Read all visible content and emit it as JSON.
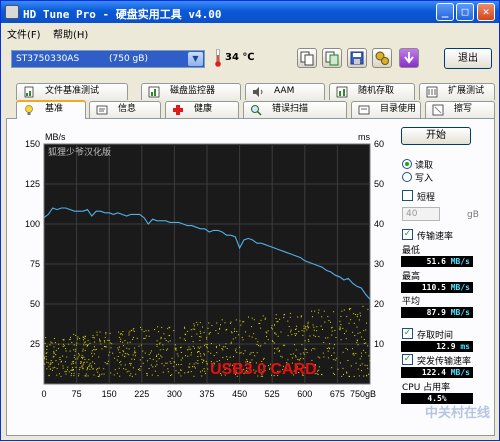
{
  "window": {
    "title": "HD Tune Pro - 硬盘实用工具 v4.00",
    "minimize_glyph": "_",
    "maximize_glyph": "□",
    "close_glyph": "✕"
  },
  "menu": {
    "file": "文件(F)",
    "help": "帮助(H)"
  },
  "toolbar": {
    "drive": "ST3750330AS",
    "drive_size": "(750 gB)",
    "temperature": "34 ℃",
    "exit_label": "退出",
    "icons": [
      "copy-text-icon",
      "copy-screenshot-icon",
      "save-icon",
      "settings-icon",
      "download-icon"
    ]
  },
  "tabs_top": [
    {
      "label": "文件基准测试",
      "icon": "file-benchmark-icon"
    },
    {
      "label": "磁盘监控器",
      "icon": "disk-monitor-icon"
    },
    {
      "label": "AAM",
      "icon": "speaker-icon"
    },
    {
      "label": "随机存取",
      "icon": "random-access-icon"
    },
    {
      "label": "扩展测试",
      "icon": "extra-tests-icon"
    }
  ],
  "tabs_bottom": [
    {
      "label": "基准",
      "icon": "lightbulb-icon"
    },
    {
      "label": "信息",
      "icon": "info-icon"
    },
    {
      "label": "健康",
      "icon": "health-cross-icon"
    },
    {
      "label": "错误扫描",
      "icon": "magnifier-icon"
    },
    {
      "label": "目录使用",
      "icon": "folder-icon"
    },
    {
      "label": "擦写",
      "icon": "erase-icon"
    }
  ],
  "side": {
    "start_label": "开始",
    "read_label": "读取",
    "write_label": "写入",
    "short_label": "短程",
    "short_value": "40",
    "short_unit": "gB",
    "transfer_rate_label": "传输速率",
    "min_label": "最低",
    "min_value": "51.6",
    "max_label": "最高",
    "max_value": "110.5",
    "avg_label": "平均",
    "avg_value": "87.9",
    "rate_unit": "MB/s",
    "access_time_label": "存取时间",
    "access_time_value": "12.9",
    "access_time_unit": "ms",
    "burst_label": "突发传输速率",
    "burst_value": "122.4",
    "cpu_label": "CPU 占用率",
    "cpu_value": "4.5%"
  },
  "watermark": "中关村在线",
  "chart_data": {
    "type": "line",
    "left_axis_label": "MB/s",
    "right_axis_label": "ms",
    "left_ticks": [
      150,
      125,
      100,
      75,
      50,
      25
    ],
    "right_ticks": [
      60,
      50,
      40,
      30,
      20,
      10
    ],
    "x_ticks": [
      "0",
      "75",
      "150",
      "225",
      "300",
      "375",
      "450",
      "525",
      "600",
      "675",
      "750gB"
    ],
    "ylim": [
      0,
      150
    ],
    "y2lim": [
      0,
      60
    ],
    "xlim": [
      0,
      750
    ],
    "grid": true,
    "annotation": "狐狸少爷汉化版",
    "overlay_text": "USB3.0 CARD",
    "series": [
      {
        "color": "#4fb0e8",
        "x": [
          0,
          10,
          20,
          30,
          40,
          50,
          60,
          70,
          80,
          90,
          100,
          110,
          120,
          130,
          140,
          150,
          160,
          170,
          180,
          190,
          200,
          210,
          220,
          230,
          240,
          250,
          260,
          270,
          280,
          290,
          300,
          310,
          320,
          330,
          340,
          350,
          360,
          370,
          380,
          390,
          400,
          410,
          420,
          430,
          440,
          450,
          460,
          470,
          480,
          490,
          500,
          510,
          520,
          530,
          540,
          550,
          560,
          570,
          580,
          590,
          600,
          610,
          620,
          630,
          640,
          650,
          660,
          670,
          680,
          690,
          700,
          710,
          720,
          730,
          740,
          750
        ],
        "y": [
          104,
          106,
          110,
          109,
          110,
          110,
          109,
          108,
          108,
          108,
          109,
          105,
          108,
          108,
          107,
          107,
          106,
          107,
          106,
          105,
          106,
          106,
          106,
          104,
          100,
          103,
          102,
          102,
          102,
          101,
          101,
          101,
          100,
          99,
          99,
          98,
          97,
          97,
          95,
          96,
          96,
          95,
          93,
          93,
          92,
          85,
          90,
          91,
          90,
          88,
          88,
          87,
          86,
          85,
          84,
          83,
          82,
          81,
          80,
          79,
          77,
          76,
          75,
          74,
          73,
          71,
          70,
          68,
          67,
          65,
          66,
          63,
          61,
          60,
          56,
          53
        ]
      }
    ],
    "access_scatter": {
      "color": "#e8e000",
      "y2_range_ms": [
        2,
        20
      ]
    }
  }
}
